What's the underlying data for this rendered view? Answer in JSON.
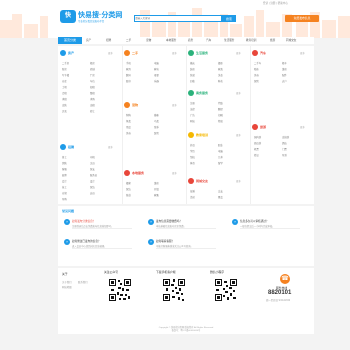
{
  "topbar": {
    "links": "登录 | 注册 | 帮助中心"
  },
  "brand": {
    "logo_mark": "快",
    "name": "快易搜·分类网",
    "tagline": "专业的分类信息发布平台"
  },
  "search": {
    "placeholder": "请输入关键词",
    "button": "搜索"
  },
  "post_button": "免费发布信息",
  "nav": {
    "home": "首页分类",
    "items": [
      "房产",
      "招聘",
      "二手",
      "宠物",
      "本地服务",
      "商务",
      "汽车",
      "生活服务",
      "教育培训",
      "旅游",
      "同城交友"
    ]
  },
  "categories": [
    {
      "title": "房产",
      "more": "更多",
      "color": "#1e9be8",
      "links": [
        "二手房",
        "租房",
        "新房",
        "商铺",
        "写字楼",
        "厂房",
        "仓库",
        "车位",
        "土地",
        "短租",
        "合租",
        "整租",
        "求租",
        "求购",
        "出售",
        "出租",
        "买卖",
        "转让"
      ]
    },
    {
      "title": "招聘",
      "more": "更多",
      "color": "#1e9be8",
      "links": [
        "普工",
        "司机",
        "销售",
        "文员",
        "客服",
        "保安",
        "厨师",
        "服务员",
        "会计",
        "设计",
        "技工",
        "保洁",
        "仓管",
        "店员",
        "导购"
      ]
    },
    {
      "title": "二手",
      "more": "更多",
      "color": "#f58220",
      "links": [
        "手机",
        "电脑",
        "家具",
        "家电",
        "数码",
        "母婴",
        "图书",
        "乐器"
      ]
    },
    {
      "title": "宠物",
      "more": "更多",
      "color": "#f58220",
      "links": [
        "狗狗",
        "猫咪",
        "鱼类",
        "鸟类",
        "用品",
        "寄养",
        "美容",
        "医院"
      ]
    },
    {
      "title": "本地服务",
      "more": "更多",
      "color": "#e8463a",
      "links": [
        "搬家",
        "维修",
        "保洁",
        "开锁",
        "管道",
        "家教",
        "月嫂",
        "保姆"
      ]
    },
    {
      "title": "生活服务",
      "more": "更多",
      "color": "#2ab27b",
      "links": [
        "婚庆",
        "摄影",
        "装修",
        "家政",
        "快递",
        "洗衣",
        "回收",
        "鲜花"
      ]
    },
    {
      "title": "商务服务",
      "more": "更多",
      "color": "#2ab27b",
      "links": [
        "注册",
        "代账",
        "法律",
        "翻译",
        "广告",
        "印刷",
        "网站",
        "物流"
      ]
    },
    {
      "title": "教育培训",
      "more": "更多",
      "color": "#f5b800",
      "links": [
        "外语",
        "职业",
        "学历",
        "电脑",
        "驾校",
        "艺术",
        "体育",
        "留学"
      ]
    },
    {
      "title": "汽车",
      "more": "更多",
      "color": "#e8463a",
      "links": [
        "二手车",
        "租车",
        "陪练",
        "维修",
        "美容",
        "配件",
        "保险",
        "过户"
      ]
    },
    {
      "title": "旅游",
      "more": "更多",
      "color": "#e8463a",
      "links": [
        "国内游",
        "出境游",
        "周边游",
        "酒店",
        "机票",
        "门票",
        "签证",
        "导游"
      ]
    },
    {
      "title": "同城交友",
      "more": "更多",
      "color": "#e8463a",
      "links": [
        "征婚",
        "交友",
        "活动",
        "聚会"
      ]
    }
  ],
  "faq": {
    "title": "常见问题",
    "items": [
      {
        "q": "如何发布分类信息？",
        "a": "注册登录后点击免费发布信息按钮即可。"
      },
      {
        "q": "发布信息需要收费吗？",
        "a": "本站基础信息发布完全免费。"
      },
      {
        "q": "信息多久可以审核通过？",
        "a": "一般在提交后一小时内完成审核。"
      },
      {
        "q": "如何修改已发布的信息？",
        "a": "进入会员中心找到对应信息编辑。"
      },
      {
        "q": "如何联系客服？",
        "a": "可拨打客服热线或关注公众号咨询。"
      }
    ]
  },
  "footer": {
    "about_title": "关于",
    "about_links": [
      "关于我们",
      "联系我们",
      "网站地图"
    ],
    "qr1": "关注公众号",
    "qr2": "下载手机客户端",
    "qr3": "微信小程序",
    "hotline_label": "服务热线",
    "phone": "8820101",
    "hotline_hours": "周一至周日 9:00-18:00"
  },
  "copyright": [
    "Copyright © 快易搜分类网 版权所有 All Rights Reserved",
    "备案号：粤ICP备00000000号"
  ]
}
